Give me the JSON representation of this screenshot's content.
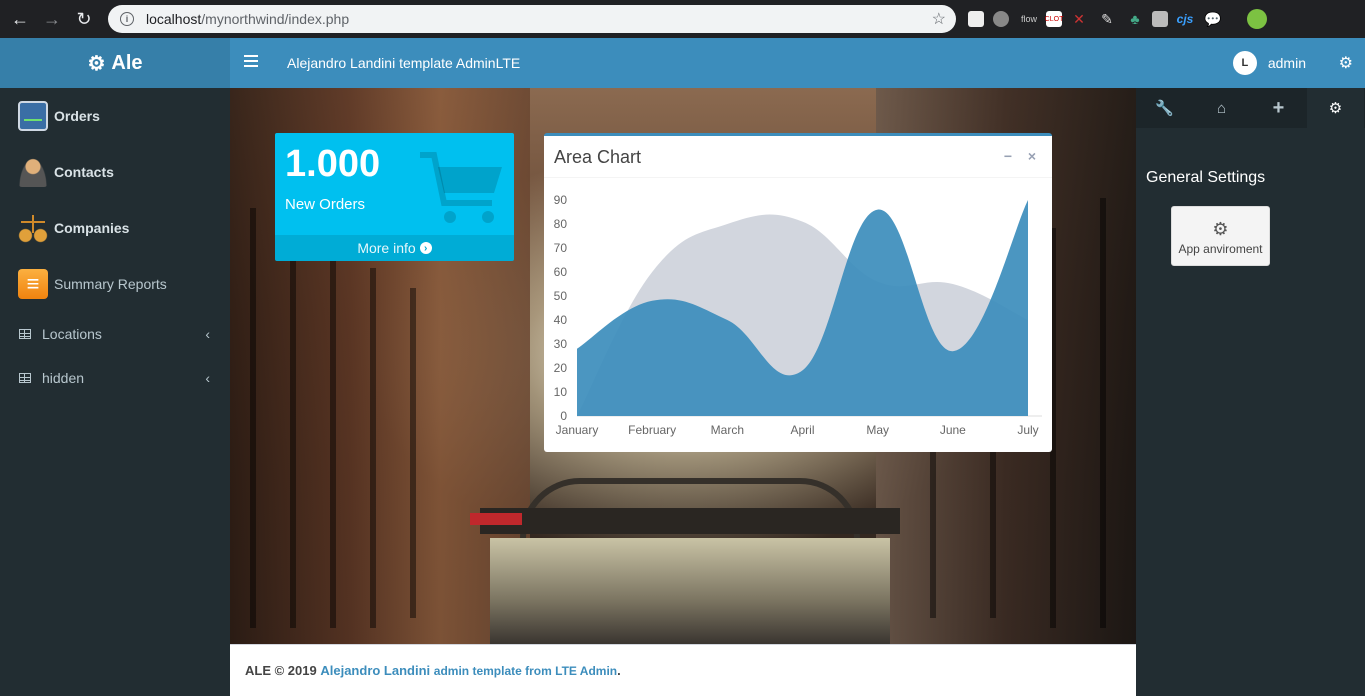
{
  "browser": {
    "url_host": "localhost",
    "url_path": "/mynorthwind/index.php",
    "extensions": [
      "flow",
      "CLOT",
      "cjs"
    ]
  },
  "header": {
    "logo_text": "Ale",
    "site_title": "Alejandro Landini template AdminLTE",
    "user_name": "admin",
    "avatar_letter": "L"
  },
  "sidebar": {
    "items": [
      {
        "label": "Orders",
        "icon": "orders-monitor-icon"
      },
      {
        "label": "Contacts",
        "icon": "contacts-person-icon"
      },
      {
        "label": "Companies",
        "icon": "companies-scales-icon"
      },
      {
        "label": "Summary Reports",
        "icon": "reports-list-icon"
      },
      {
        "label": "Locations",
        "icon": "table-icon"
      },
      {
        "label": "hidden",
        "icon": "table-icon"
      }
    ]
  },
  "small_box": {
    "number": "1.000",
    "text": "New Orders",
    "more_info": "More info",
    "color": "#00c0ef"
  },
  "chart_box": {
    "title": "Area Chart",
    "minimize_symbol": "−",
    "close_symbol": "×"
  },
  "chart_data": {
    "type": "area",
    "title": "Area Chart",
    "categories": [
      "January",
      "February",
      "March",
      "April",
      "May",
      "June",
      "July"
    ],
    "series": [
      {
        "color": "#d2d6de",
        "values": [
          0,
          60,
          80,
          81,
          56,
          55,
          40
        ]
      },
      {
        "color": "#3c8dbc",
        "values": [
          28,
          48,
          40,
          19,
          86,
          27,
          90
        ]
      }
    ],
    "ylim": [
      0,
      90
    ],
    "yticks": [
      0,
      10,
      20,
      30,
      40,
      50,
      60,
      70,
      80,
      90
    ],
    "xlabel": "",
    "ylabel": ""
  },
  "footer": {
    "prefix": "ALE © 2019",
    "author": "Alejandro Landini",
    "suffix": "admin template from LTE Admin",
    "period": "."
  },
  "control_sidebar": {
    "tabs": [
      "wrench-icon",
      "home-icon",
      "plus-icon",
      "cogs-icon"
    ],
    "heading": "General Settings",
    "app_button": "App anviroment"
  }
}
